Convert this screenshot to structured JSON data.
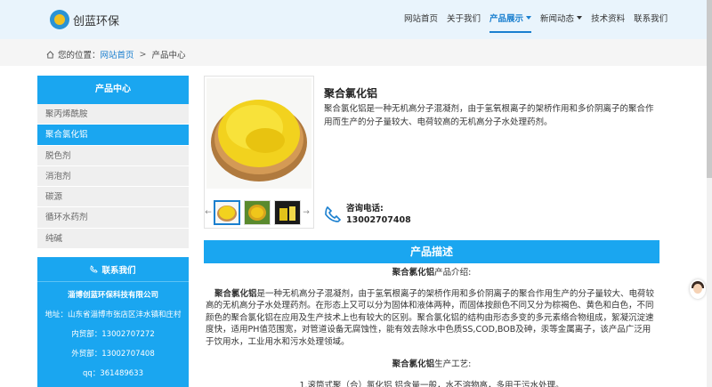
{
  "header": {
    "logo_text": "创蓝环保",
    "nav": [
      {
        "label": "网站首页",
        "active": false,
        "caret": false
      },
      {
        "label": "关于我们",
        "active": false,
        "caret": false
      },
      {
        "label": "产品展示",
        "active": true,
        "caret": true
      },
      {
        "label": "新闻动态",
        "active": false,
        "caret": true
      },
      {
        "label": "技术资料",
        "active": false,
        "caret": false
      },
      {
        "label": "联系我们",
        "active": false,
        "caret": false
      }
    ]
  },
  "breadcrumb": {
    "prefix": "您的位置：",
    "home": "网站首页",
    "separator": ">",
    "current": "产品中心"
  },
  "sidebar": {
    "title": "产品中心",
    "items": [
      {
        "label": "聚丙烯酰胺",
        "active": false
      },
      {
        "label": "聚合氯化铝",
        "active": true
      },
      {
        "label": "脱色剂",
        "active": false
      },
      {
        "label": "消泡剂",
        "active": false
      },
      {
        "label": "碳源",
        "active": false
      },
      {
        "label": "循环水药剂",
        "active": false
      },
      {
        "label": "纯碱",
        "active": false
      }
    ]
  },
  "contact": {
    "title": "联系我们",
    "company": "淄博创蓝环保科技有限公司",
    "address": "地址：山东省淄博市张店区沣水镇和庄村",
    "sales_inner": "内贸部：13002707272",
    "sales_outer": "外贸部：13002707408",
    "qq": "qq：361489633"
  },
  "product": {
    "title": "聚合氯化铝",
    "description": "聚合氯化铝是一种无机高分子混凝剂，由于氢氧根离子的架桥作用和多价阴离子的聚合作用而生产的分子量较大、电荷较高的无机高分子水处理药剂。",
    "hotline_label": "咨询电话:",
    "hotline_number": "13002707408",
    "prev_arrow": "←",
    "next_arrow": "→"
  },
  "section": {
    "title": "产品描述"
  },
  "article": {
    "intro_bold": "聚合氯化铝",
    "intro_rest": "产品介绍:",
    "body_bold": "聚合氯化铝",
    "body_rest": "是一种无机高分子混凝剂，由于氢氧根离子的架桥作用和多价阴离子的聚合作用生产的分子量较大、电荷较高的无机高分子水处理药剂。在形态上又可以分为固体和液体两种，而固体按颜色不同又分为棕褐色、黄色和白色，不同颜色的聚合氯化铝在应用及生产技术上也有较大的区别。聚合氯化铝的结构由形态多变的多元素络合物组成，絮凝沉淀速度快，适用PH值范围宽，对管道设备无腐蚀性，能有效去除水中色质SS,COD,BOB及砷，汞等金属离子，该产品广泛用于饮用水，工业用水和污水处理领域。",
    "process_bold": "聚合氯化铝",
    "process_rest": "生产工艺:",
    "process_item": "1.滚筒式聚（合）氯化铝 铝含量一般，水不溶物高，多用于污水处理。"
  },
  "colors": {
    "accent": "#1aa6f0",
    "link": "#1a7fcf",
    "header_bg": "#e9f4fc",
    "powder": "#f2d21e"
  }
}
